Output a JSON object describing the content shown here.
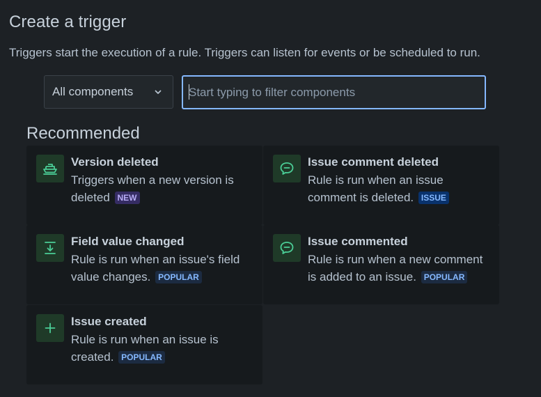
{
  "header": {
    "title": "Create a trigger",
    "description": "Triggers start the execution of a rule. Triggers can listen for events or be scheduled to run."
  },
  "filters": {
    "component_select_value": "All components",
    "search_placeholder": "Start typing to filter components",
    "search_value": ""
  },
  "recommended": {
    "title": "Recommended",
    "items": [
      {
        "title": "Version deleted",
        "description": "Triggers when a new version is deleted",
        "badge": "NEW",
        "icon": "ship-icon"
      },
      {
        "title": "Issue comment deleted",
        "description": "Rule is run when an issue comment is deleted.",
        "badge": "ISSUE",
        "icon": "comment-icon"
      },
      {
        "title": "Field value changed",
        "description": "Rule is run when an issue's field value changes.",
        "badge": "POPULAR",
        "icon": "download-arrow-icon"
      },
      {
        "title": "Issue commented",
        "description": "Rule is run when a new comment is added to an issue.",
        "badge": "POPULAR",
        "icon": "comment-icon"
      },
      {
        "title": "Issue created",
        "description": "Rule is run when an issue is created.",
        "badge": "POPULAR",
        "icon": "plus-icon"
      }
    ]
  },
  "colors": {
    "background": "#1d2125",
    "card_background": "#161a1d",
    "icon_tile": "#1f3a28",
    "icon_stroke": "#4bce97",
    "focus_border": "#85b8ff"
  }
}
